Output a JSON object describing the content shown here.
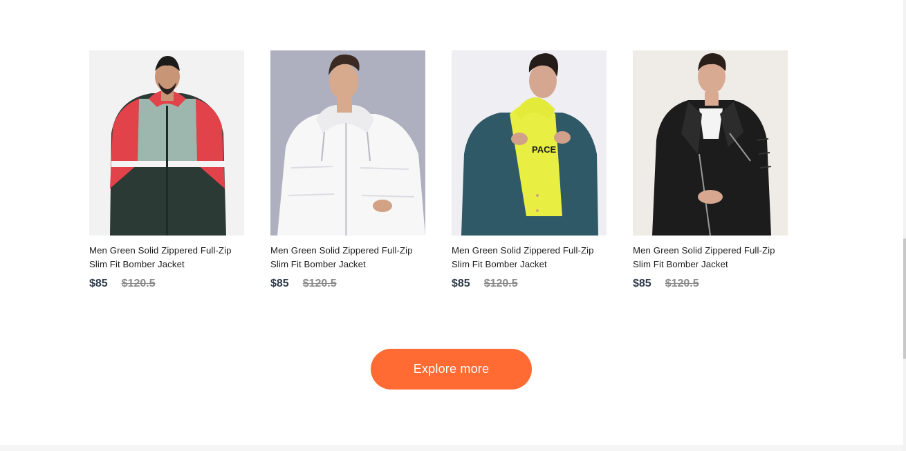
{
  "products": [
    {
      "name": "Men Green Solid Zippered Full-Zip Slim Fit Bomber Jacket",
      "price": "$85",
      "old_price": "$120.5",
      "image_alt": "Man wearing red, grey and dark green windbreaker jacket",
      "colors": {
        "bg": "#f2f2f2",
        "jacket": "#2b3a35",
        "accent": "#e2424a",
        "panel": "#9db7ae"
      }
    },
    {
      "name": "Men Green Solid Zippered Full-Zip Slim Fit Bomber Jacket",
      "price": "$85",
      "old_price": "$120.5",
      "image_alt": "Man wearing white hooded puffer jacket",
      "colors": {
        "bg": "#aeb0bf",
        "jacket": "#f7f7f7",
        "accent": "#e6e6ea",
        "panel": "#ffffff"
      }
    },
    {
      "name": "Men Green Solid Zippered Full-Zip Slim Fit Bomber Jacket",
      "price": "$85",
      "old_price": "$120.5",
      "image_alt": "Man wearing teal denim jacket over yellow hoodie",
      "colors": {
        "bg": "#eeeef3",
        "jacket": "#2f5967",
        "accent": "#e9ef42",
        "panel": "#ffffff"
      }
    },
    {
      "name": "Men Green Solid Zippered Full-Zip Slim Fit Bomber Jacket",
      "price": "$85",
      "old_price": "$120.5",
      "image_alt": "Man wearing black leather biker jacket",
      "colors": {
        "bg": "#efebe6",
        "jacket": "#1c1c1c",
        "accent": "#3a3a3a",
        "panel": "#f4f4f4"
      }
    }
  ],
  "explore_button": {
    "label": "Explore more",
    "color": "#ff6b33"
  }
}
